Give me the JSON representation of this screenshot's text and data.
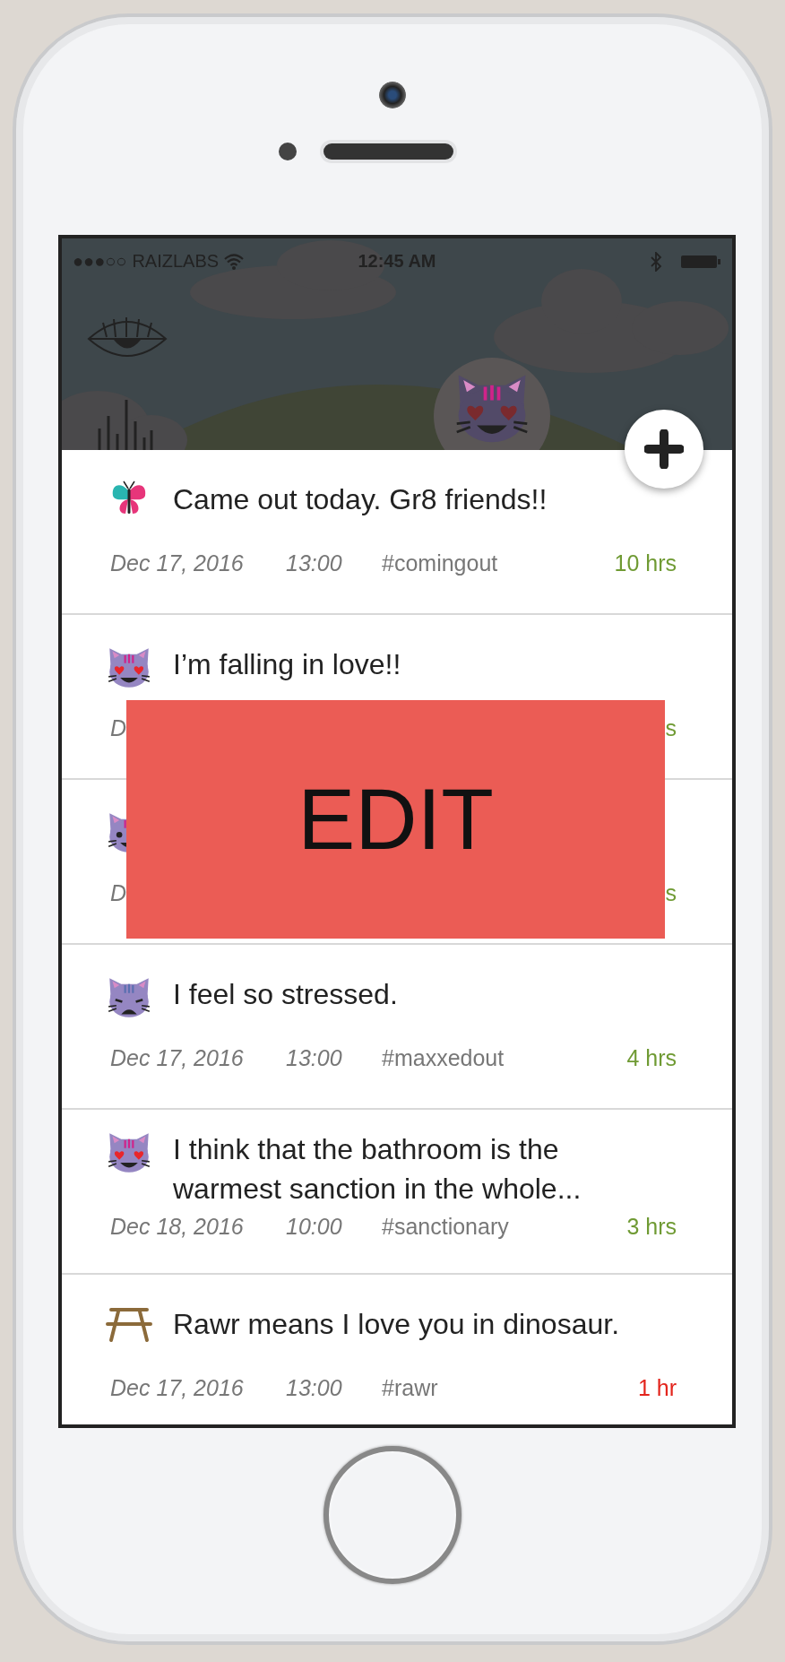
{
  "status_bar": {
    "signal": "●●●○○",
    "carrier": "RAIZLABS",
    "time": "12:45 AM"
  },
  "posts": [
    {
      "kind": "butterfly",
      "text": "Came out today. Gr8 friends!!",
      "date": "Dec 17, 2016",
      "time": "13:00",
      "tag": "#comingout",
      "age": "10 hrs",
      "color": "#6f9a33"
    },
    {
      "kind": "cat-love",
      "text": "I’m falling in love!!",
      "date": "D",
      "age": "s",
      "color": "#6f9a33"
    },
    {
      "kind": "cat-smile",
      "date": "D",
      "age": "s",
      "color": "#6f9a33"
    },
    {
      "kind": "cat-stressed",
      "text": "I feel so stressed.",
      "date": "Dec 17, 2016",
      "time": "13:00",
      "tag": "#maxxedout",
      "age": "4 hrs",
      "color": "#6f9a33"
    },
    {
      "kind": "cat-love",
      "text": "I think that the bathroom is the warmest sanction in the whole...",
      "date": "Dec 18, 2016",
      "time": "10:00",
      "tag": "#sanctionary",
      "age": "3 hrs",
      "color": "#6f9a33"
    },
    {
      "kind": "table",
      "text": "Rawr means I love you in dinosaur.",
      "date": "Dec 17, 2016",
      "time": "13:00",
      "tag": "#rawr",
      "age": "1 hr",
      "color": "#e3241c"
    }
  ],
  "edit_overlay": {
    "label": "EDIT"
  }
}
